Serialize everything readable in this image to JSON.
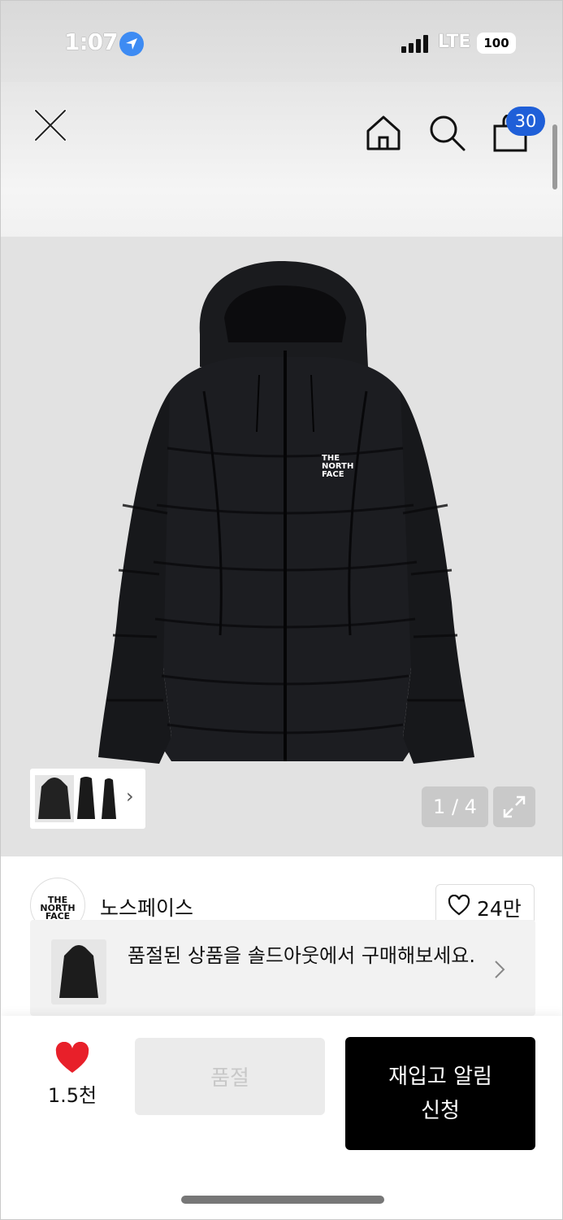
{
  "status_bar": {
    "time": "1:07",
    "network": "LTE",
    "battery": "100"
  },
  "nav": {
    "cart_count": "30",
    "icons": [
      "close-icon",
      "home-icon",
      "search-icon",
      "shopping-bag-icon"
    ]
  },
  "gallery": {
    "page_indicator": "1 / 4",
    "thumbnail_count": 3
  },
  "brand": {
    "logo_text": "THE NORTH FACE",
    "name": "노스페이스",
    "likes": "24만"
  },
  "banner": {
    "text": "품절된 상품을 솔드아웃에서 구매해보세요."
  },
  "bottom_bar": {
    "wish_count": "1.5천",
    "soldout_label": "품절",
    "restock_label": "재입고 알림 신청"
  },
  "colors": {
    "badge": "#1f5fd8",
    "heart": "#e8202a",
    "primary_button": "#000000",
    "disabled_button": "#ebebeb"
  }
}
